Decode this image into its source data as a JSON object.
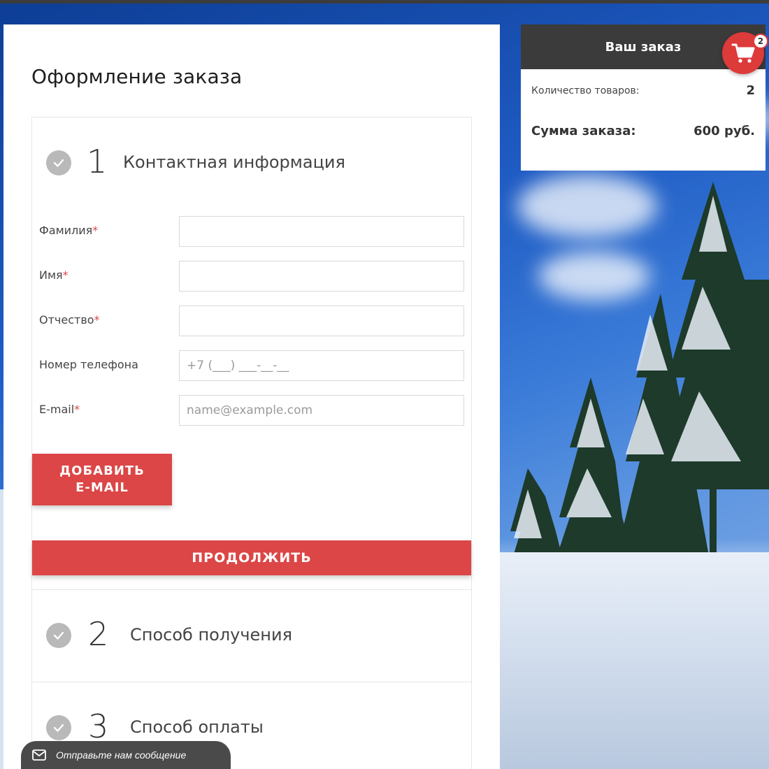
{
  "page_title": "Оформление заказа",
  "steps": [
    {
      "number": "1",
      "title": "Контактная информация"
    },
    {
      "number": "2",
      "title": "Способ получения"
    },
    {
      "number": "3",
      "title": "Способ оплаты"
    }
  ],
  "contact_form": {
    "fields": [
      {
        "label": "Фамилия",
        "required_mark": "*",
        "value": "",
        "placeholder": ""
      },
      {
        "label": "Имя",
        "required_mark": "*",
        "value": "",
        "placeholder": ""
      },
      {
        "label": "Отчество",
        "required_mark": "*",
        "value": "",
        "placeholder": ""
      },
      {
        "label": "Номер телефона",
        "required_mark": "",
        "value": "",
        "placeholder": "+7 (___) ___-__-__"
      },
      {
        "label": "E-mail",
        "required_mark": "*",
        "value": "",
        "placeholder": "name@example.com"
      }
    ],
    "add_email_label": "ДОБАВИТЬ E-MAIL",
    "continue_label": "ПРОДОЛЖИТЬ"
  },
  "order": {
    "header": "Ваш заказ",
    "qty_label": "Количество товаров:",
    "qty_value": "2",
    "sum_label": "Сумма заказа:",
    "sum_value": "600 руб."
  },
  "cart": {
    "badge": "2",
    "icon": "cart-icon"
  },
  "chat": {
    "label": "Отправьте нам сообщение",
    "icon": "envelope-icon"
  },
  "colors": {
    "accent": "#dc4646",
    "header_dark": "#3b3b3b",
    "check_gray": "#b9b9b9"
  }
}
